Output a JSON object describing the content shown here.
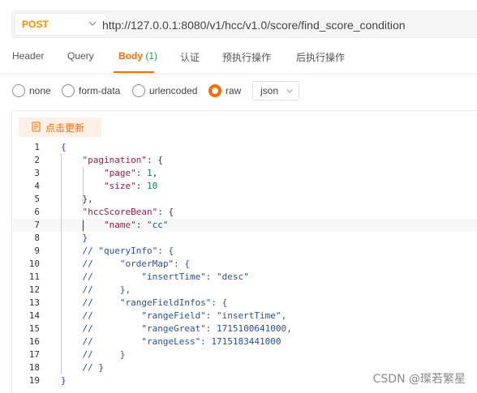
{
  "request": {
    "method": "POST",
    "url": "http://127.0.0.1:8080/v1/hcc/v1.0/score/find_score_condition"
  },
  "tabs": [
    {
      "label": "Header"
    },
    {
      "label": "Query"
    },
    {
      "label": "Body",
      "count": "(1)",
      "active": true
    },
    {
      "label": "认证"
    },
    {
      "label": "预执行操作"
    },
    {
      "label": "后执行操作"
    }
  ],
  "body_types": [
    {
      "label": "none",
      "checked": false
    },
    {
      "label": "form-data",
      "checked": false
    },
    {
      "label": "urlencoded",
      "checked": false
    },
    {
      "label": "raw",
      "checked": true
    }
  ],
  "format": {
    "selected": "json"
  },
  "editor": {
    "beautify_label": "点击更新",
    "lines": [
      {
        "n": "1",
        "text": "{"
      },
      {
        "n": "2",
        "text": "    \"pagination\": {"
      },
      {
        "n": "3",
        "text": "        \"page\": 1,"
      },
      {
        "n": "4",
        "text": "        \"size\": 10"
      },
      {
        "n": "5",
        "text": "    },"
      },
      {
        "n": "6",
        "text": "    \"hccScoreBean\": {"
      },
      {
        "n": "7",
        "text": "        \"name\": \"cc\""
      },
      {
        "n": "8",
        "text": "    }"
      },
      {
        "n": "9",
        "text": "    // \"queryInfo\": {"
      },
      {
        "n": "10",
        "text": "    //     \"orderMap\": {"
      },
      {
        "n": "11",
        "text": "    //         \"insertTime\": \"desc\""
      },
      {
        "n": "12",
        "text": "    //     },"
      },
      {
        "n": "13",
        "text": "    //     \"rangeFieldInfos\": {"
      },
      {
        "n": "14",
        "text": "    //         \"rangeField\": \"insertTime\","
      },
      {
        "n": "15",
        "text": "    //         \"rangeGreat\": 1715100641000,"
      },
      {
        "n": "16",
        "text": "    //         \"rangeLess\": 1715183441000"
      },
      {
        "n": "17",
        "text": "    //     }"
      },
      {
        "n": "18",
        "text": "    // }"
      },
      {
        "n": "19",
        "text": "}"
      }
    ]
  },
  "watermark": "CSDN @璨若繁星",
  "colors": {
    "accent": "#ff6a00",
    "method": "#ff8c00",
    "count": "#2aa44f"
  }
}
